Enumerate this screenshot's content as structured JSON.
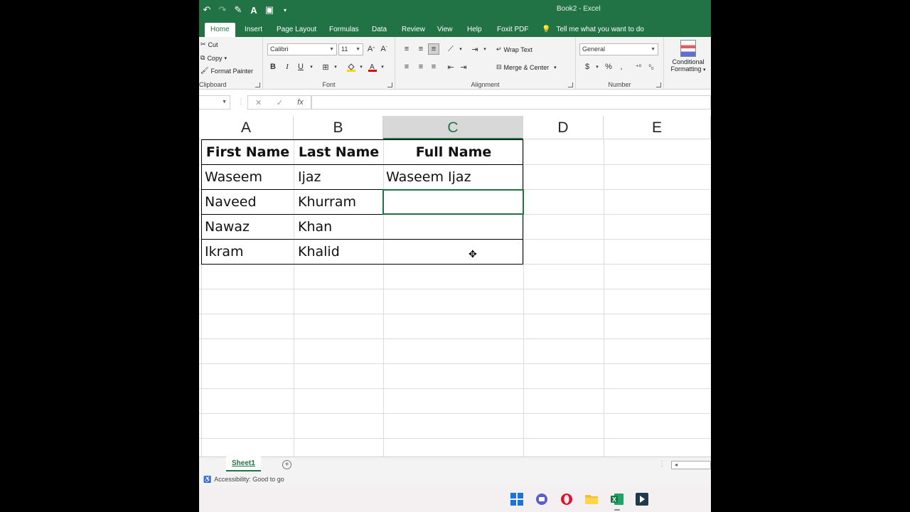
{
  "titlebar": {
    "title": "Book2 - Excel"
  },
  "tabs": [
    "Home",
    "Insert",
    "Page Layout",
    "Formulas",
    "Data",
    "Review",
    "View",
    "Help",
    "Foxit PDF"
  ],
  "tell_me": "Tell me what you want to do",
  "ribbon": {
    "clipboard": {
      "cut": "Cut",
      "copy": "Copy",
      "format_painter": "Format Painter",
      "label": "Clipboard"
    },
    "font": {
      "name": "Calibri",
      "size": "11",
      "label": "Font",
      "bold": "B",
      "italic": "I",
      "underline": "U"
    },
    "alignment": {
      "wrap_text": "Wrap Text",
      "merge_center": "Merge & Center",
      "label": "Alignment"
    },
    "number": {
      "format": "General",
      "label": "Number",
      "currency": "$",
      "percent": "%",
      "comma": ","
    },
    "styles": {
      "conditional_formatting_1": "Conditional",
      "conditional_formatting_2": "Formatting"
    }
  },
  "formula_bar": {
    "name_box": "",
    "fx": "fx",
    "cancel": "✕",
    "enter": "✓",
    "content": ""
  },
  "columns": [
    "A",
    "B",
    "C",
    "D",
    "E"
  ],
  "selected_column": "C",
  "table": {
    "headers": [
      "First Name",
      "Last Name",
      "Full Name"
    ],
    "rows": [
      [
        "Waseem",
        "Ijaz",
        "Waseem Ijaz"
      ],
      [
        "Naveed",
        "Khurram",
        ""
      ],
      [
        "Nawaz",
        "Khan",
        ""
      ],
      [
        "Ikram",
        "Khalid",
        ""
      ]
    ]
  },
  "sheet_tabs": {
    "active": "Sheet1",
    "add": "+"
  },
  "status": {
    "accessibility": "Accessibility: Good to go"
  },
  "colors": {
    "accent": "#217346",
    "ribbon_bg": "#f3f3f3"
  }
}
